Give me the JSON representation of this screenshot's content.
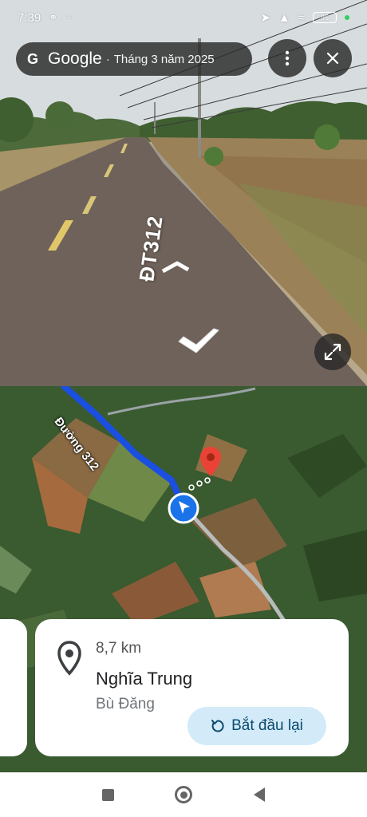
{
  "status_bar": {
    "time": "7:39",
    "battery": "95"
  },
  "street_view": {
    "brand": "Google",
    "capture_date": "Tháng 3 năm 2025",
    "road_marker": "ĐT312",
    "more_icon": "more-vert-icon",
    "close_icon": "close-icon",
    "expand_icon": "expand-icon"
  },
  "map": {
    "road_label": "Đường 312",
    "pin_color": "#ea4335",
    "route_color": "#1a4fe0",
    "location_color": "#1a73e8"
  },
  "destination_card": {
    "distance": "8,7 km",
    "place_name": "Nghĩa Trung",
    "region": "Bù Đăng",
    "restart_label": "Bắt đầu lại"
  },
  "nav_bar": {
    "recents_icon": "recents-icon",
    "home_icon": "home-icon",
    "back_icon": "back-icon"
  }
}
